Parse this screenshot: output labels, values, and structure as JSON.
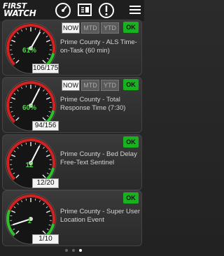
{
  "header": {
    "logo_line1": "FIRST",
    "logo_line2": "WATCH",
    "icons": [
      "dashboard-gauge-icon",
      "report-icon",
      "alert-icon",
      "menu-icon"
    ]
  },
  "segment_labels": [
    "NOW",
    "MTD",
    "YTD"
  ],
  "ok_label": "OK",
  "cards": [
    {
      "title": "Prime County - ALS Time-on-Task (60 min)",
      "count": "106/175",
      "percent": "61%",
      "selected_segment": "NOW",
      "level": 0.61
    },
    {
      "title": "Prime County - Total Response Time (7:30)",
      "count": "94/156",
      "percent": "60%",
      "selected_segment": "NOW",
      "level": 0.6
    },
    {
      "title": "Prime County - Bed Delay Free-Text Sentinel",
      "count": "12/20",
      "percent": "12",
      "level": 0.6
    },
    {
      "title": "Prime County - Super User Location Event",
      "count": "1/10",
      "percent": "1",
      "level": 0.1
    }
  ],
  "pager": {
    "pages": 3,
    "current": 3
  },
  "colors": {
    "ok_green": "#19b11f",
    "value_green": "#55d04b",
    "gauge_red": "#d42121",
    "gauge_green": "#2fbf2f"
  }
}
